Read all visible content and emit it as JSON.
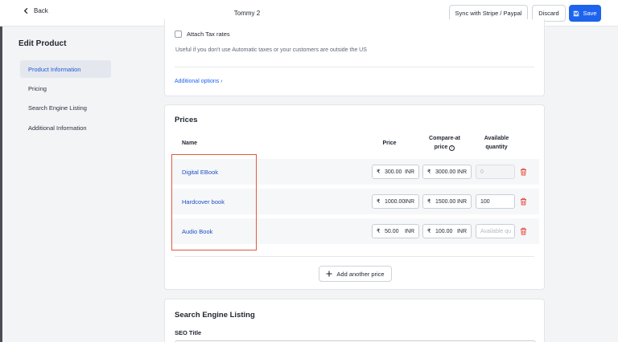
{
  "topbar": {
    "back_label": "Back",
    "page_name": "Tommy 2",
    "sync_label": "Sync with Stripe / Paypal",
    "discard_label": "Discard",
    "save_label": "Save"
  },
  "sidebar": {
    "title": "Edit Product",
    "items": [
      {
        "label": "Product Information",
        "active": true
      },
      {
        "label": "Pricing"
      },
      {
        "label": "Search Engine Listing"
      },
      {
        "label": "Additional Information"
      }
    ]
  },
  "tax": {
    "checkbox_label": "Attach Tax rates",
    "help_text": "Useful if you don't use Automatic taxes or your customers are outside the US",
    "additional_options": "Additional options"
  },
  "prices": {
    "title": "Prices",
    "columns": {
      "name": "Name",
      "price": "Price",
      "compare_line1": "Compare-at",
      "compare_line2": "price",
      "available_line1": "Available",
      "available_line2": "quantity"
    },
    "currency_symbol": "₹",
    "currency_code": "INR",
    "rows": [
      {
        "name": "Digital EBook",
        "price": "300.00",
        "compare": "3000.00",
        "quantity": "0"
      },
      {
        "name": "Hardcover book",
        "price": "1000.00",
        "compare": "1500.00",
        "quantity": "100"
      },
      {
        "name": "Audio Book",
        "price": "50.00",
        "compare": "100.00",
        "quantity_placeholder": "Available qu"
      }
    ],
    "add_label": "Add another price"
  },
  "seo": {
    "title": "Search Engine Listing",
    "seo_title_label": "SEO Title"
  },
  "colors": {
    "accent": "#1d63ed",
    "highlight": "#e05a3c",
    "delete": "#e5483c"
  }
}
